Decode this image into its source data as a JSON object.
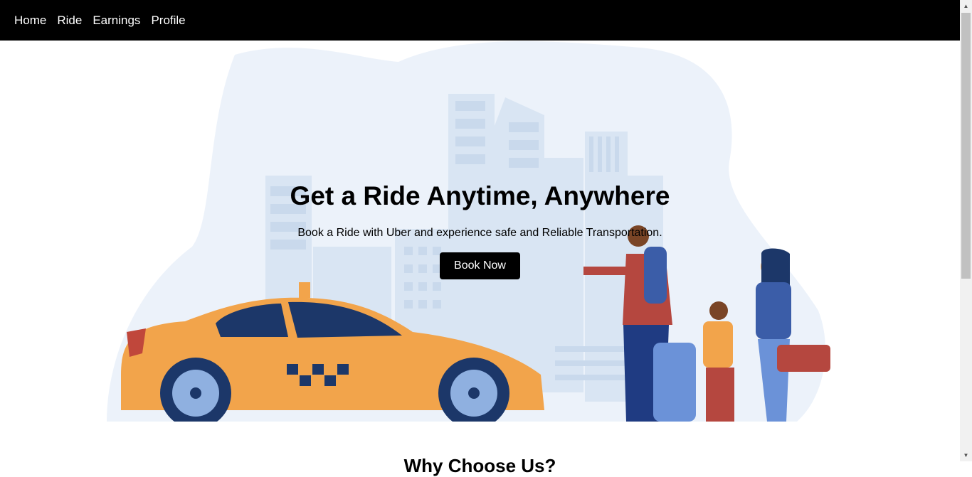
{
  "nav": {
    "items": [
      {
        "label": "Home"
      },
      {
        "label": "Ride"
      },
      {
        "label": "Earnings"
      },
      {
        "label": "Profile"
      }
    ]
  },
  "hero": {
    "title": "Get a Ride Anytime, Anywhere",
    "subtitle": "Book a Ride with Uber and experience safe and Reliable Transportation.",
    "cta_label": "Book Now",
    "illustration": "taxi-and-travelers-illustration"
  },
  "section": {
    "title": "Why Choose Us?"
  },
  "scrollbar": {
    "up_icon": "▲",
    "down_icon": "▼"
  },
  "colors": {
    "nav_bg": "#000000",
    "button_bg": "#000000",
    "taxi": "#f2a44b",
    "city": "#dbe7f4"
  }
}
